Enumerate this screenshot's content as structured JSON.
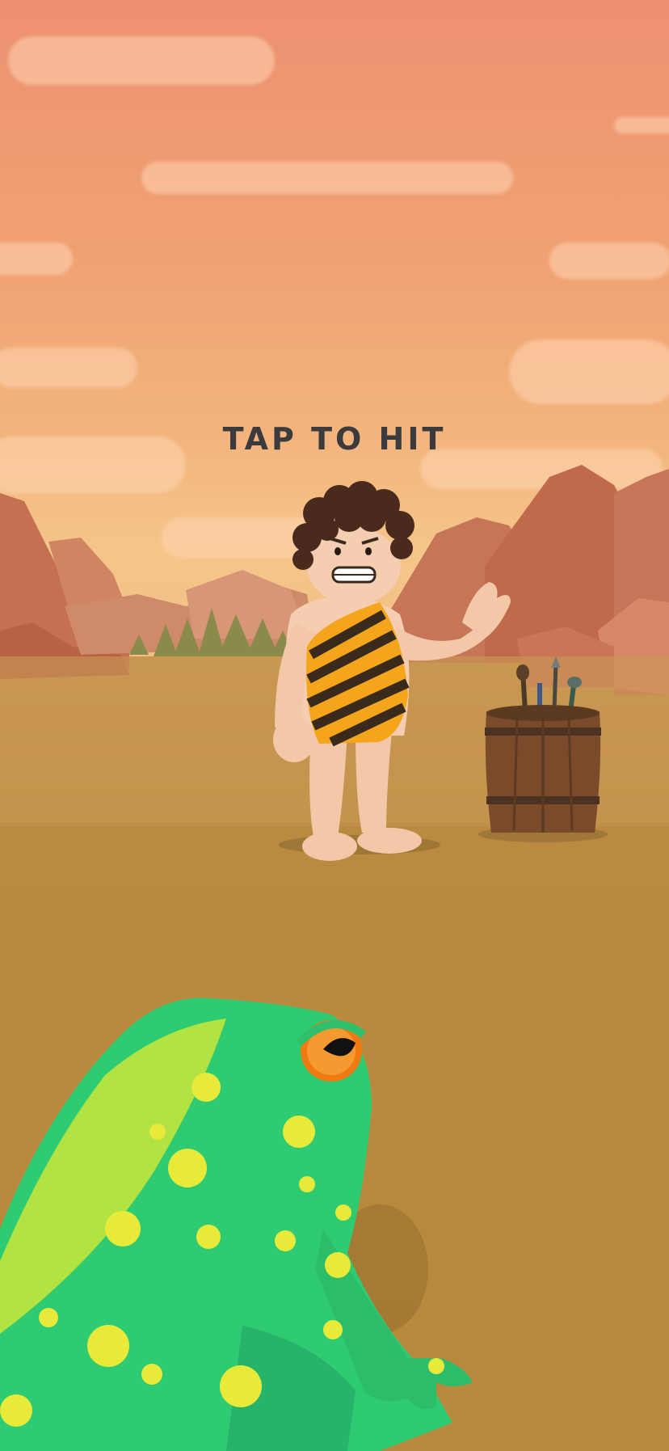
{
  "hud": {
    "hint_text": "TAP TO HIT"
  },
  "colors": {
    "sky_top": "#ee9071",
    "sky_bottom": "#f5c58a",
    "ground": "#b8883c",
    "mountains": "#c67556",
    "caveman_skin": "#f5cdb0",
    "caveman_tunic_stripe_1": "#f4a51c",
    "caveman_tunic_stripe_2": "#3a2a1c",
    "frog_body": "#2ecb73",
    "frog_spots": "#e8ea3a",
    "frog_eye": "#f07a12",
    "barrel": "#7a4a2b"
  },
  "scene": {
    "characters": [
      "caveman",
      "frog"
    ],
    "props": [
      "barrel-of-weapons",
      "pine-trees",
      "red-rock-mountains",
      "clouds"
    ]
  }
}
